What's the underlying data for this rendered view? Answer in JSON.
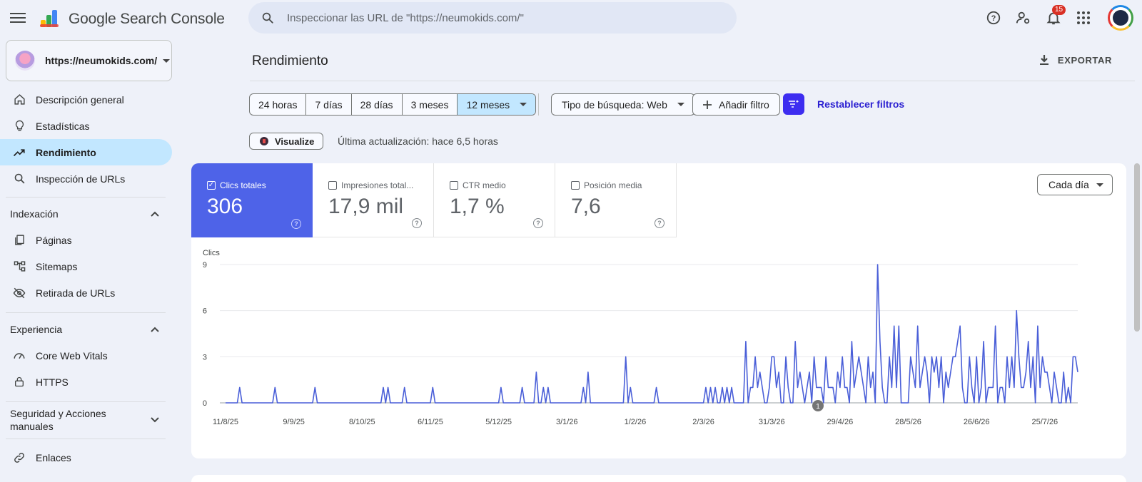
{
  "app": {
    "title": "Google Search Console",
    "search_placeholder": "Inspeccionar las URL de \"https://neumokids.com/\"",
    "notifications_count": "15"
  },
  "sidebar": {
    "property": "https://neumokids.com/",
    "items": [
      {
        "label": "Descripción general",
        "icon": "home-icon"
      },
      {
        "label": "Estadísticas",
        "icon": "lightbulb-icon"
      },
      {
        "label": "Rendimiento",
        "icon": "trending-up-icon",
        "active": true
      },
      {
        "label": "Inspección de URLs",
        "icon": "search-icon"
      }
    ],
    "sections": [
      {
        "title": "Indexación",
        "items": [
          {
            "label": "Páginas",
            "icon": "pages-icon"
          },
          {
            "label": "Sitemaps",
            "icon": "sitemap-icon"
          },
          {
            "label": "Retirada de URLs",
            "icon": "eye-off-icon"
          }
        ]
      },
      {
        "title": "Experiencia",
        "items": [
          {
            "label": "Core Web Vitals",
            "icon": "speedometer-icon"
          },
          {
            "label": "HTTPS",
            "icon": "lock-icon"
          }
        ]
      },
      {
        "title": "Seguridad y Acciones manuales",
        "items": []
      }
    ],
    "links_label": "Enlaces"
  },
  "main": {
    "title": "Rendimiento",
    "export_label": "EXPORTAR",
    "ranges": [
      "24 horas",
      "7 días",
      "28 días",
      "3 meses",
      "12 meses"
    ],
    "selected_range": "12 meses",
    "search_type": "Tipo de búsqueda: Web",
    "add_filter": "Añadir filtro",
    "reset_filters": "Restablecer filtros",
    "visualize": "Visualize",
    "last_update": "Última actualización: hace 6,5 horas",
    "period": "Cada día",
    "metrics": [
      {
        "label": "Clics totales",
        "value": "306",
        "active": true
      },
      {
        "label": "Impresiones total...",
        "value": "17,9 mil",
        "active": false
      },
      {
        "label": "CTR medio",
        "value": "1,7 %",
        "active": false
      },
      {
        "label": "Posición media",
        "value": "7,6",
        "active": false
      }
    ],
    "annotation_marker": "1"
  },
  "colors": {
    "accent": "#4e63e8",
    "line": "#4a5fd8",
    "selected": "#c2e7ff"
  },
  "chart_data": {
    "type": "line",
    "ylabel": "Clics",
    "ylim": [
      0,
      9
    ],
    "yticks": [
      0,
      3,
      6,
      9
    ],
    "x_tick_labels": [
      "11/8/25",
      "9/9/25",
      "8/10/25",
      "6/11/25",
      "5/12/25",
      "3/1/26",
      "1/2/26",
      "2/3/26",
      "31/3/26",
      "29/4/26",
      "28/5/26",
      "26/6/26",
      "25/7/26"
    ],
    "x_start": "2025-08-11",
    "series": [
      {
        "values": [
          0,
          0,
          0,
          0,
          0,
          0,
          1,
          0,
          0,
          0,
          0,
          0,
          0,
          0,
          0,
          0,
          0,
          0,
          0,
          0,
          0,
          1,
          0,
          0,
          0,
          0,
          0,
          0,
          0,
          0,
          0,
          0,
          0,
          0,
          0,
          0,
          0,
          0,
          1,
          0,
          0,
          0,
          0,
          0,
          0,
          0,
          0,
          0,
          0,
          0,
          0,
          0,
          0,
          0,
          0,
          0,
          0,
          0,
          0,
          0,
          0,
          0,
          0,
          0,
          0,
          0,
          0,
          1,
          0,
          1,
          0,
          0,
          0,
          0,
          0,
          0,
          1,
          0,
          0,
          0,
          0,
          0,
          0,
          0,
          0,
          0,
          0,
          0,
          1,
          0,
          0,
          0,
          0,
          0,
          0,
          0,
          0,
          0,
          0,
          0,
          0,
          0,
          0,
          0,
          0,
          0,
          0,
          0,
          0,
          0,
          0,
          0,
          0,
          0,
          0,
          0,
          0,
          1,
          0,
          0,
          0,
          0,
          0,
          0,
          0,
          0,
          1,
          0,
          0,
          0,
          0,
          0,
          2,
          0,
          0,
          1,
          0,
          1,
          0,
          0,
          0,
          0,
          0,
          0,
          0,
          0,
          0,
          0,
          0,
          0,
          0,
          0,
          1,
          0,
          2,
          0,
          0,
          0,
          0,
          0,
          0,
          0,
          0,
          0,
          0,
          0,
          0,
          0,
          0,
          0,
          3,
          0,
          1,
          0,
          0,
          0,
          0,
          0,
          0,
          0,
          0,
          0,
          0,
          1,
          0,
          0,
          0,
          0,
          0,
          0,
          0,
          0,
          0,
          0,
          0,
          0,
          0,
          0,
          0,
          0,
          0,
          0,
          0,
          0,
          1,
          0,
          1,
          0,
          1,
          0,
          0,
          1,
          0,
          1,
          0,
          1,
          0,
          0,
          0,
          0,
          0,
          4,
          0,
          1,
          1,
          3,
          1,
          2,
          1,
          0,
          0,
          1,
          3,
          3,
          1,
          2,
          0,
          0,
          3,
          1,
          0,
          0,
          4,
          1,
          2,
          1,
          0,
          1,
          2,
          0,
          3,
          1,
          1,
          1,
          0,
          3,
          1,
          1,
          1,
          0,
          2,
          1,
          3,
          1,
          1,
          0,
          4,
          1,
          2,
          3,
          2,
          1,
          0,
          3,
          1,
          2,
          0,
          9,
          4,
          1,
          0,
          0,
          3,
          1,
          5,
          1,
          5,
          0,
          0,
          0,
          0,
          3,
          2,
          1,
          5,
          1,
          2,
          3,
          2,
          0,
          3,
          2,
          3,
          1,
          3,
          0,
          2,
          1,
          2,
          3,
          3,
          4,
          5,
          1,
          0,
          0,
          3,
          1,
          0,
          3,
          0,
          1,
          4,
          0,
          1,
          1,
          1,
          5,
          0,
          1,
          1,
          0,
          3,
          1,
          3,
          1,
          6,
          3,
          1,
          1,
          2,
          4,
          1,
          3,
          0,
          5,
          1,
          3,
          2,
          2,
          1,
          0,
          2,
          1,
          0,
          0,
          2,
          0,
          1,
          0,
          3,
          3,
          2
        ]
      }
    ]
  }
}
